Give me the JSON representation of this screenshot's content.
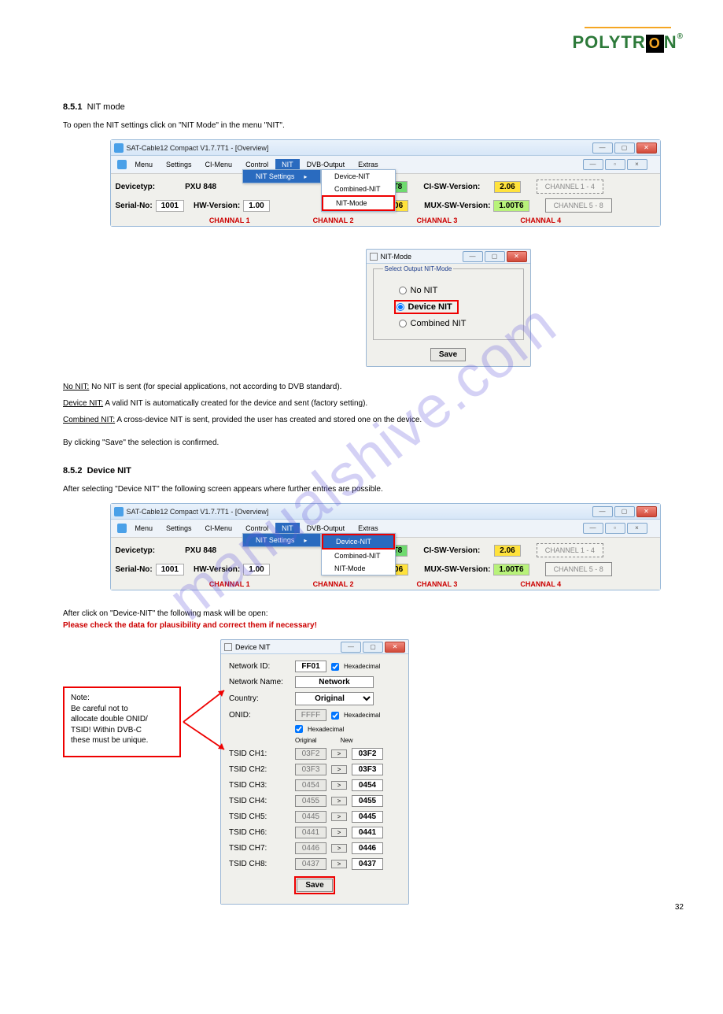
{
  "logo_text_pre": "POLYTR",
  "logo_text_o": "O",
  "logo_text_post": "N",
  "logo_suffix": "®",
  "section1": {
    "heading_prefix": "8.5.1",
    "heading_rest": "NIT mode",
    "intro": "To open the NIT settings click on \"NIT Mode\" in the menu \"NIT\"."
  },
  "screenshot1": {
    "title": "SAT-Cable12 Compact V1.7.7T1 - [Overview]",
    "menu": [
      "Menu",
      "Settings",
      "CI-Menu",
      "Control",
      "NIT",
      "DVB-Output",
      "Extras"
    ],
    "submenu1": "NIT Settings",
    "submenu2": [
      "Device-NIT",
      "Combined-NIT",
      "NIT-Mode"
    ],
    "devicetyp_lbl": "Devicetyp:",
    "devicetyp": "PXU 848",
    "serial_lbl": "Serial-No:",
    "serial": "1001",
    "hwv_lbl": "HW-Version:",
    "hwv": "1.00",
    "fw": "1.49T8",
    "ci_lbl": "CI-SW-Version:",
    "ci": "2.06",
    "mux_lbl": "MUX-SW-Version:",
    "mux": "1.00T6",
    "u406": "4.06",
    "ch14": "CHANNEL 1 - 4",
    "ch58": "CHANNEL 5 - 8",
    "channels": [
      "CHANNAL 1",
      "CHANNAL 2",
      "CHANNAL 3",
      "CHANNAL 4"
    ]
  },
  "nit_mode_dialog": {
    "title": "NIT-Mode",
    "legend": "Select Output NIT-Mode",
    "options": [
      "No NIT",
      "Device NIT",
      "Combined NIT"
    ],
    "save": "Save"
  },
  "defs": [
    {
      "u": "No NIT:",
      "rest": " No NIT is sent (for special applications, not according to DVB standard)."
    },
    {
      "u": "Device NIT:",
      "rest": " A valid NIT is automatically created for the device and sent (factory setting)."
    },
    {
      "u": "Combined NIT:",
      "rest": " A cross-device NIT is sent, provided the user has created and stored one on the device."
    }
  ],
  "save_text": "By clicking \"Save\" the selection is confirmed.",
  "section2": {
    "heading_prefix": "8.5.2",
    "heading_rest": "Device NIT",
    "intro": "After selecting \"Device NIT\" the following screen appears where further entries are possible.",
    "note1_pre": "After click on \"Device-NIT\" the following mask will be open:",
    "note2": "Please check the data for plausibility and correct them if necessary!"
  },
  "device_nit_dialog": {
    "title": "Device NIT",
    "rows": [
      {
        "label": "Network ID:",
        "value": "FF01",
        "hex": "Hexadecimal"
      },
      {
        "label": "Network Name:",
        "value": "Network"
      },
      {
        "label": "Country:",
        "value": "Original"
      },
      {
        "label": "ONID:",
        "value": "FFFF",
        "hex": "Hexadecimal"
      }
    ],
    "hex_col": "Hexadecimal",
    "orig_col": "Original",
    "new_col": "New",
    "ts": [
      {
        "label": "TSID CH1:",
        "orig": "03F2",
        "new": "03F2"
      },
      {
        "label": "TSID CH2:",
        "orig": "03F3",
        "new": "03F3"
      },
      {
        "label": "TSID CH3:",
        "orig": "0454",
        "new": "0454"
      },
      {
        "label": "TSID CH4:",
        "orig": "0455",
        "new": "0455"
      },
      {
        "label": "TSID CH5:",
        "orig": "0445",
        "new": "0445"
      },
      {
        "label": "TSID CH6:",
        "orig": "0441",
        "new": "0441"
      },
      {
        "label": "TSID CH7:",
        "orig": "0446",
        "new": "0446"
      },
      {
        "label": "TSID CH8:",
        "orig": "0437",
        "new": "0437"
      }
    ],
    "save": "Save"
  },
  "note_box": {
    "l1": "Note:",
    "l2": "Be careful not to",
    "l3": "allocate double ONID/",
    "l4": "TSID! Within DVB-C",
    "l5": "these must be unique."
  },
  "page_number": "32"
}
